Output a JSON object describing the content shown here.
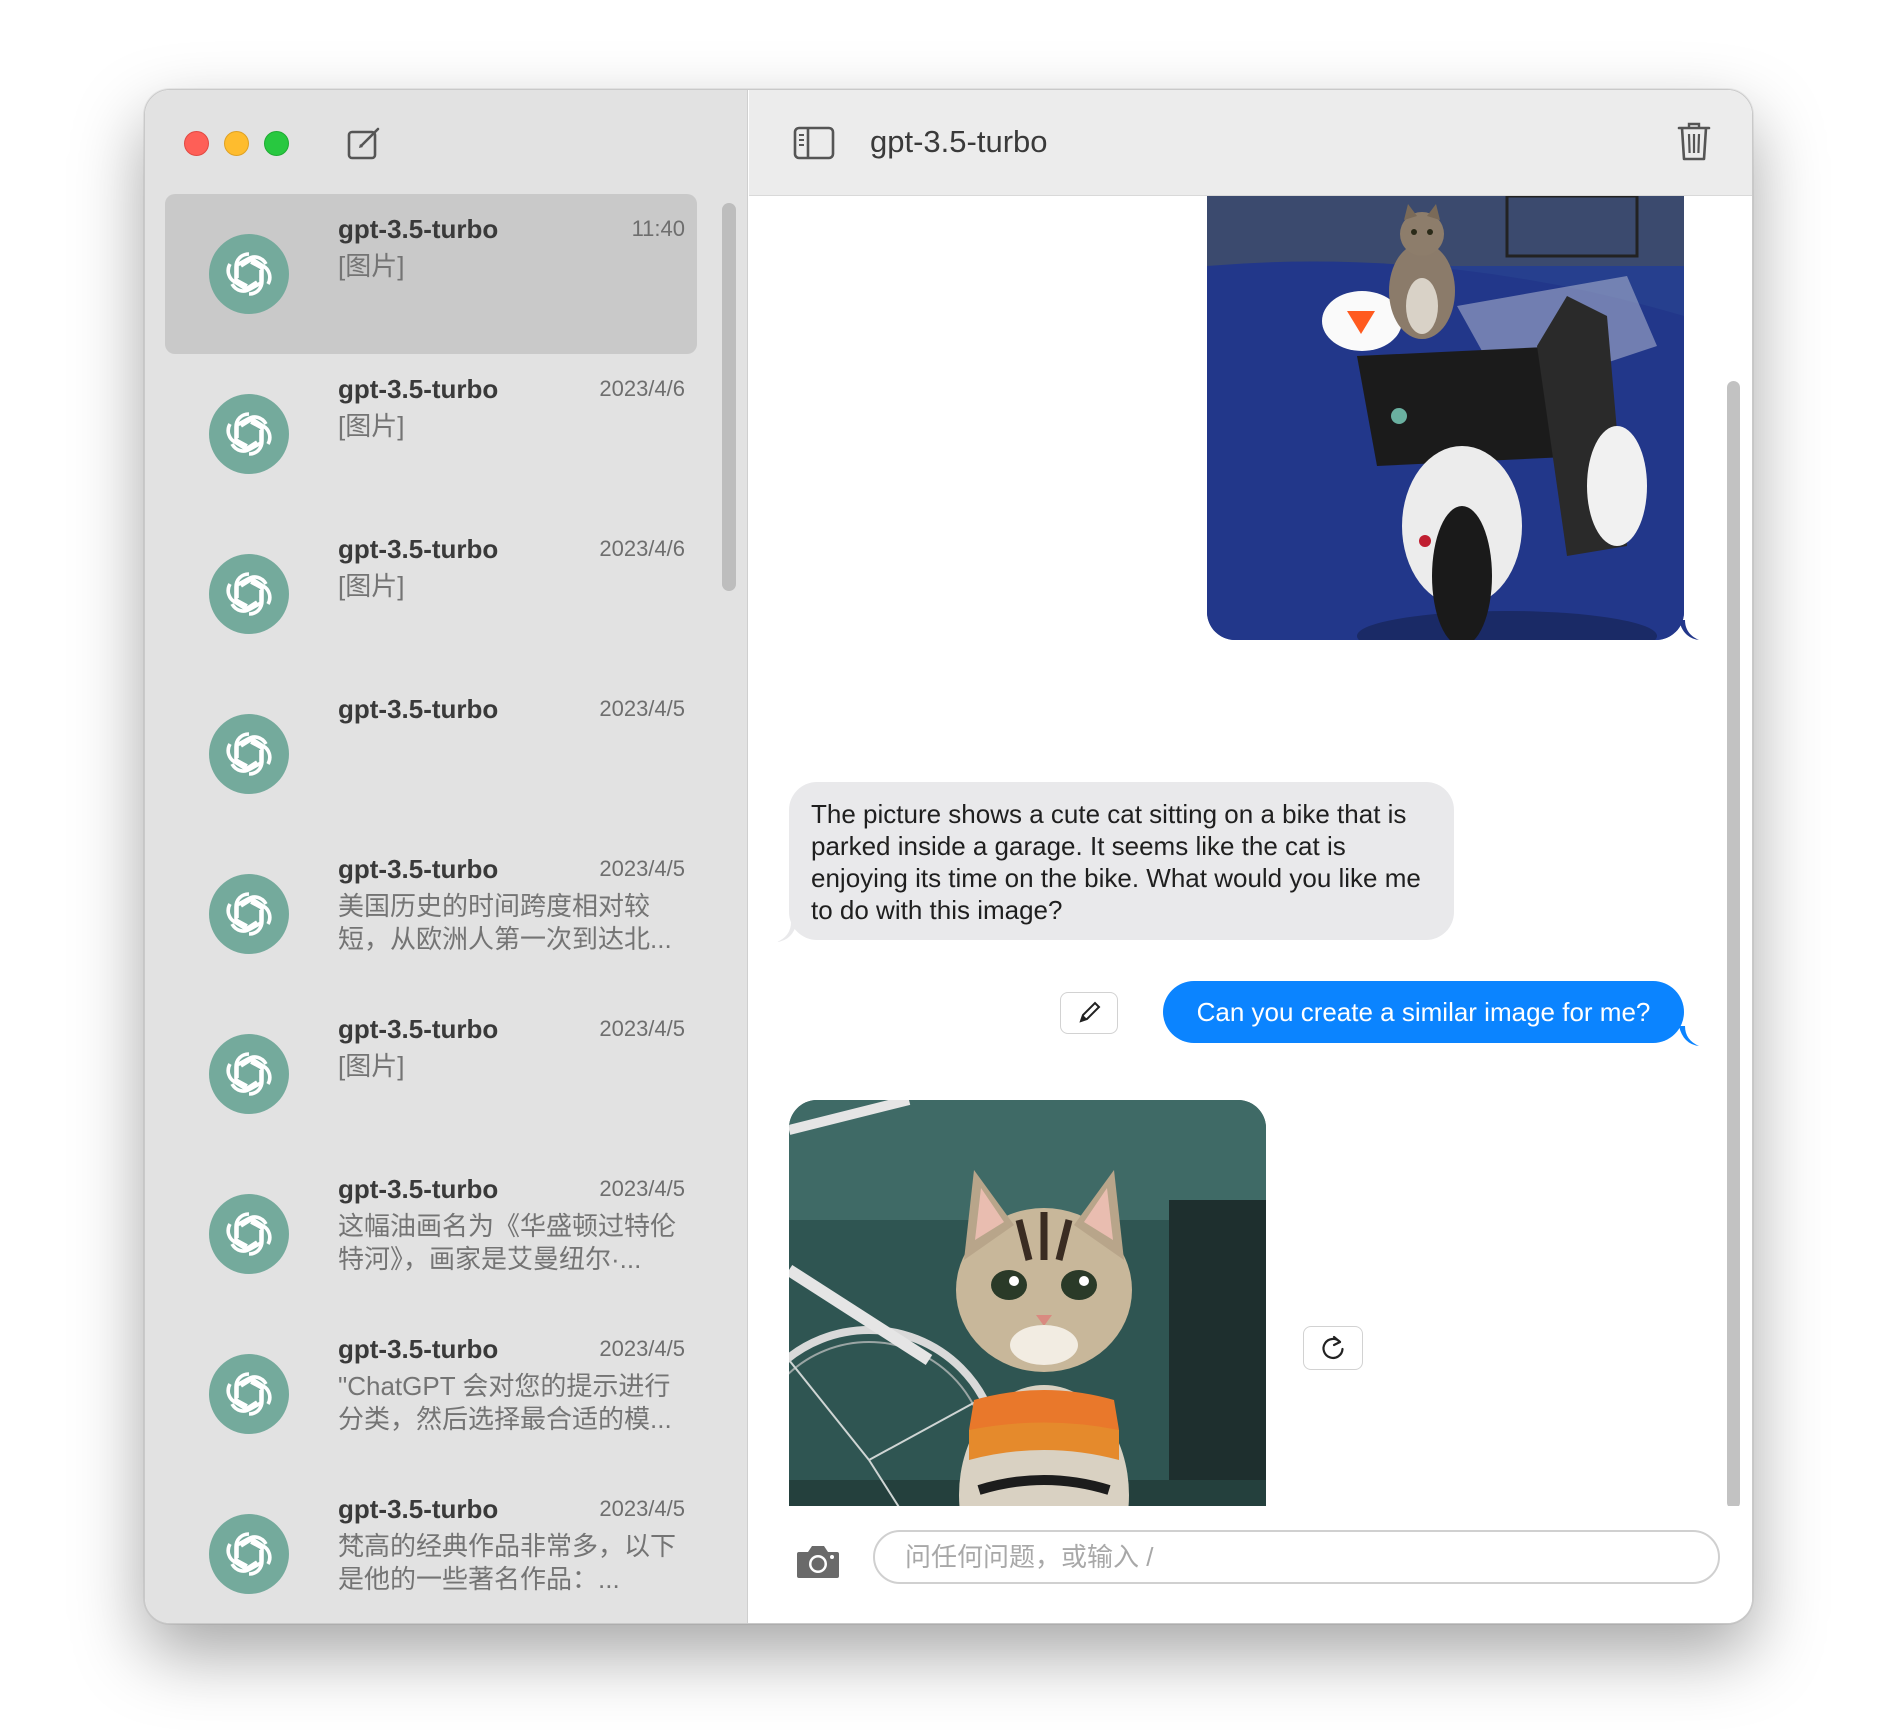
{
  "window": {
    "traffic_lights": [
      "close",
      "minimize",
      "zoom"
    ],
    "compose_icon": "compose-icon"
  },
  "sidebar": {
    "conversations": [
      {
        "title": "gpt-3.5-turbo",
        "time": "11:40",
        "preview": "[图片]",
        "selected": true
      },
      {
        "title": "gpt-3.5-turbo",
        "time": "2023/4/6",
        "preview": "[图片]"
      },
      {
        "title": "gpt-3.5-turbo",
        "time": "2023/4/6",
        "preview": "[图片]"
      },
      {
        "title": "gpt-3.5-turbo",
        "time": "2023/4/5",
        "preview": ""
      },
      {
        "title": "gpt-3.5-turbo",
        "time": "2023/4/5",
        "preview": "美国历史的时间跨度相对较短，从欧洲人第一次到达北..."
      },
      {
        "title": "gpt-3.5-turbo",
        "time": "2023/4/5",
        "preview": "[图片]"
      },
      {
        "title": "gpt-3.5-turbo",
        "time": "2023/4/5",
        "preview": "这幅油画名为《华盛顿过特伦特河》，画家是艾曼纽尔·..."
      },
      {
        "title": "gpt-3.5-turbo",
        "time": "2023/4/5",
        "preview": "\"ChatGPT 会对您的提示进行分类，然后选择最合适的模..."
      },
      {
        "title": "gpt-3.5-turbo",
        "time": "2023/4/5",
        "preview": "梵高的经典作品非常多，以下是他的一些著名作品：..."
      }
    ]
  },
  "chat": {
    "title": "gpt-3.5-turbo",
    "messages": {
      "reply_text": "The picture shows a cute cat sitting on a bike that is parked inside a garage. It seems like the cat is enjoying its time on the bike. What would you like me to do with this image?",
      "user_text": "Can you create a similar image for me?"
    },
    "input": {
      "placeholder": "问任何问题，或输入 /",
      "value": ""
    }
  },
  "colors": {
    "accent_blue": "#0b84ff",
    "avatar_green": "#74aa9c",
    "sidebar_bg": "#e2e2e2"
  }
}
